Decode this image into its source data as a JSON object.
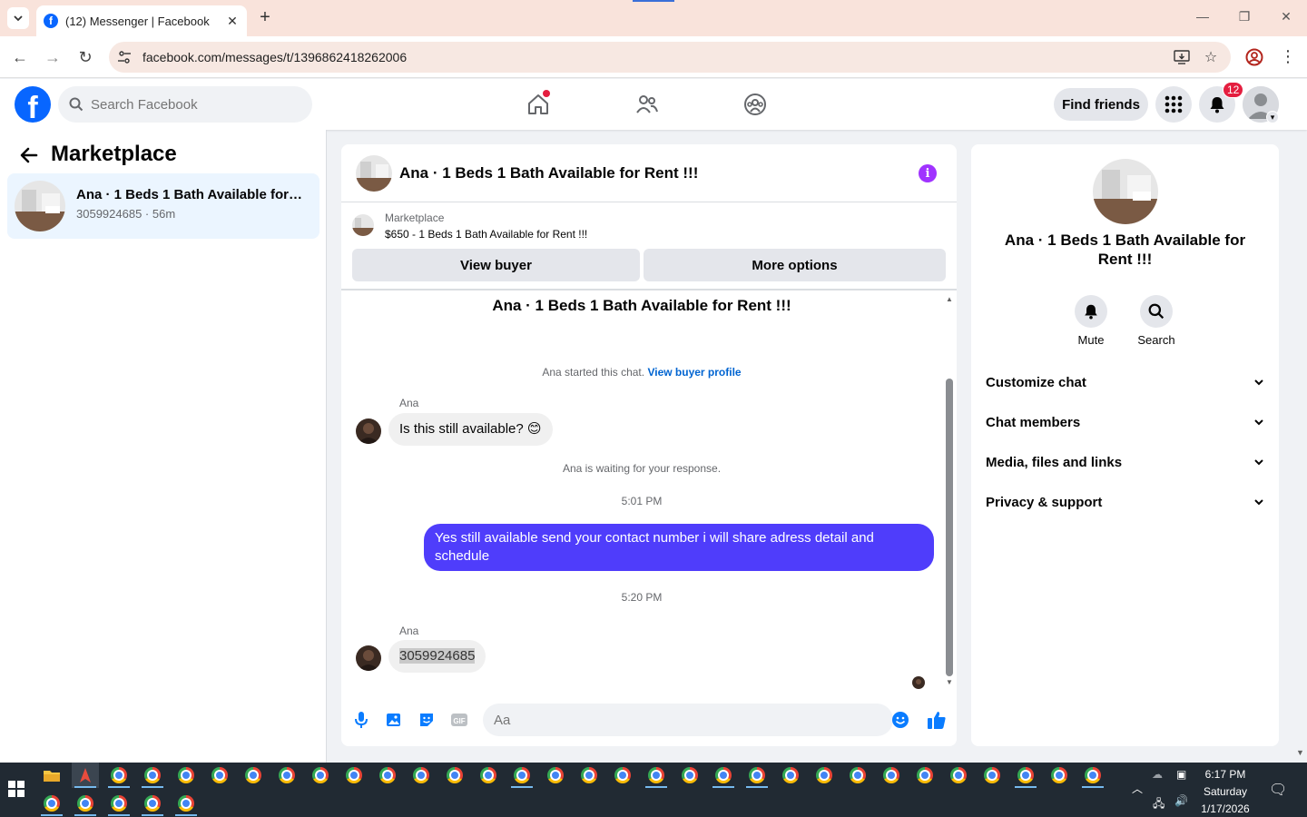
{
  "browser": {
    "tab_title": "(12) Messenger | Facebook",
    "url": "facebook.com/messages/t/1396862418262006"
  },
  "fb_header": {
    "search_placeholder": "Search Facebook",
    "find_friends": "Find friends",
    "notification_count": "12"
  },
  "sidebar": {
    "title": "Marketplace",
    "conversations": [
      {
        "name": "Ana · 1 Beds 1 Bath Available for Rent !!!",
        "subtitle": "3059924685 · 56m"
      }
    ]
  },
  "chat": {
    "header_name": "Ana · 1 Beds 1 Bath Available for Rent !!!",
    "marketplace_label": "Marketplace",
    "listing": "$650 - 1 Beds 1 Bath Available for Rent !!!",
    "view_buyer": "View buyer",
    "more_options": "More options",
    "thread_title": "Ana · 1 Beds 1 Bath Available for Rent !!!",
    "started_text": "Ana started this chat.",
    "view_buyer_profile": "View buyer profile",
    "messages": [
      {
        "sender": "Ana",
        "text": "Is this still available?",
        "emoji": "😊"
      },
      {
        "system": "Ana is waiting for your response."
      },
      {
        "timestamp": "5:01 PM"
      },
      {
        "sender": "me",
        "text": "Yes still available send your contact number i will share adress detail and schedule"
      },
      {
        "timestamp": "5:20 PM"
      },
      {
        "sender": "Ana",
        "text": "3059924685"
      }
    ],
    "composer_placeholder": "Aa"
  },
  "info_panel": {
    "name": "Ana · 1 Beds 1 Bath Available for Rent !!!",
    "actions": [
      "Mute",
      "Search"
    ],
    "sections": [
      "Customize chat",
      "Chat members",
      "Media, files and links",
      "Privacy & support"
    ]
  },
  "taskbar": {
    "time": "6:17 PM",
    "day": "Saturday",
    "date": "1/17/2026"
  },
  "colors": {
    "fb_blue": "#0866ff",
    "outgoing_bubble": "#4f3dfb",
    "info_purple": "#a033ff",
    "badge_red": "#e41e3f",
    "messenger_blue": "#0a7cff"
  }
}
